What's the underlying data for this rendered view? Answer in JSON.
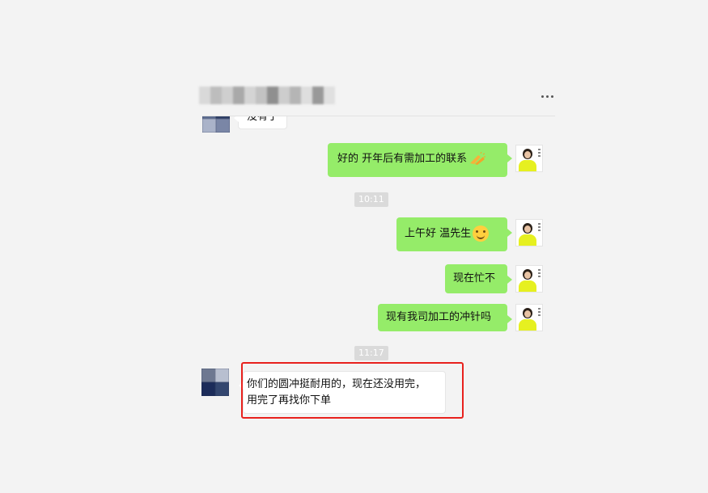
{
  "header": {
    "more_icon": "more-horizontal-icon"
  },
  "messages": {
    "m0": {
      "text": "没有了"
    },
    "m1": {
      "text": "好的 开年后有需加工的联系",
      "emoji": "clapping-hands-icon"
    },
    "t1": {
      "text": "10:11"
    },
    "m2": {
      "text": "上午好 温先生",
      "emoji": "smiling-face-icon"
    },
    "m3": {
      "text": "现在忙不"
    },
    "m4": {
      "text": "现有我司加工的冲针吗"
    },
    "t2": {
      "text": "11:17"
    },
    "m5": {
      "line1": "你们的圆冲挺耐用的，现在还没用完，",
      "line2": "用完了再找你下单"
    }
  },
  "colors": {
    "outgoing_bubble": "#95ec69",
    "incoming_bubble": "#ffffff",
    "highlight": "#e8211d",
    "background": "#f3f3f3"
  }
}
